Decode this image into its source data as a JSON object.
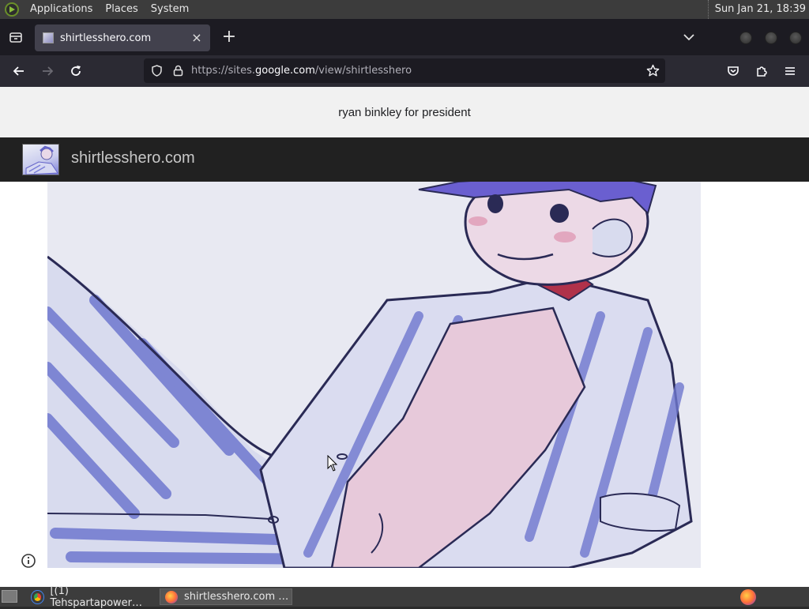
{
  "top_panel": {
    "menus": [
      "Applications",
      "Places",
      "System"
    ],
    "clock": "Sun Jan 21, 18:39"
  },
  "browser": {
    "tab": {
      "title": "shirtlesshero.com",
      "close_glyph": "×"
    },
    "new_tab_glyph": "+",
    "url": {
      "prefix": "https://sites.",
      "domain": "google.com",
      "path": "/view/shirtlesshero"
    }
  },
  "page": {
    "announcement": "ryan binkley for president",
    "site_title": "shirtlesshero.com"
  },
  "taskbar": {
    "tasks": [
      {
        "label": "[(1) Tehspartapower…",
        "icon": "chrome-icon"
      },
      {
        "label": "shirtlesshero.com …",
        "icon": "firefox-icon"
      }
    ]
  },
  "colors": {
    "panel": "#3c3c3c",
    "tab_strip": "#1c1b22",
    "nav_bar": "#2b2a33",
    "site_header": "#212121",
    "announcement_bg": "#f1f1f1"
  }
}
